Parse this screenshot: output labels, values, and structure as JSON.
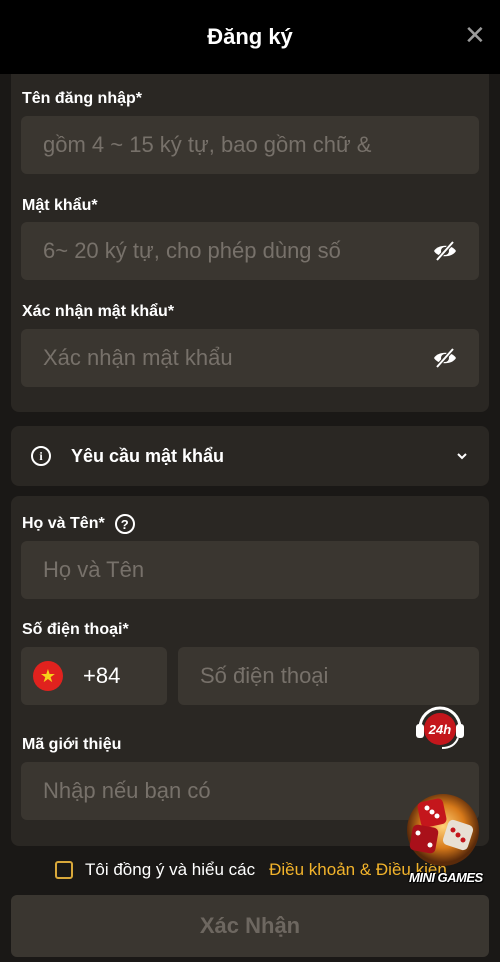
{
  "header": {
    "title": "Đăng ký",
    "close_symbol": "✕"
  },
  "form": {
    "username": {
      "label": "Tên đăng nhập*",
      "placeholder": "gồm 4 ~ 15 ký tự, bao gồm chữ &"
    },
    "password": {
      "label": "Mật khẩu*",
      "placeholder": "6~ 20 ký tự, cho phép dùng số"
    },
    "confirm_password": {
      "label": "Xác nhận mật khẩu*",
      "placeholder": "Xác nhận mật khẩu"
    },
    "password_requirements": {
      "label": "Yêu cầu mật khẩu",
      "info_symbol": "i"
    },
    "full_name": {
      "label": "Họ và Tên*",
      "placeholder": "Họ và Tên",
      "help_symbol": "?"
    },
    "phone": {
      "label": "Số điện thoại*",
      "country_code": "+84",
      "placeholder": "Số điện thoại"
    },
    "referral": {
      "label": "Mã giới thiệu",
      "placeholder": "Nhập nếu bạn có"
    }
  },
  "agreement": {
    "text": "Tôi đồng ý và hiểu các",
    "link": "Điều khoản & Điều kiện"
  },
  "submit": {
    "label": "Xác Nhận"
  },
  "floating": {
    "support_badge": "24h",
    "minigames_label": "MINI GAMES"
  },
  "colors": {
    "accent": "#f2b32b",
    "field_bg": "#3a3630",
    "card_bg": "#2a2723",
    "page_bg": "#1a1816"
  }
}
